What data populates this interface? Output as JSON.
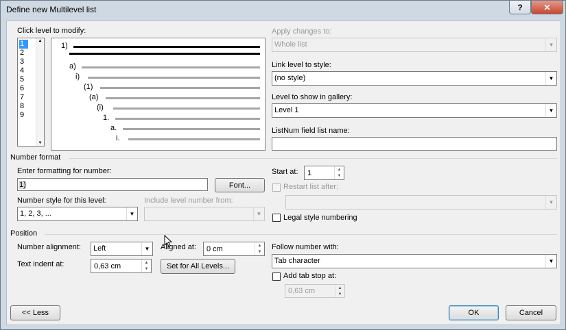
{
  "window": {
    "title": "Define new Multilevel list",
    "help_button": "?",
    "close_button": "✕"
  },
  "levels": {
    "label": "Click level to modify:",
    "items": [
      "1",
      "2",
      "3",
      "4",
      "5",
      "6",
      "7",
      "8",
      "9"
    ],
    "selected": "1"
  },
  "preview": {
    "labels": [
      "1)",
      "a)",
      "i)",
      "(1)",
      "(a)",
      "(i)",
      "1.",
      "a.",
      "i."
    ]
  },
  "apply_changes": {
    "label": "Apply changes to:",
    "value": "Whole list"
  },
  "link_level": {
    "label": "Link level to style:",
    "value": "(no style)"
  },
  "gallery_level": {
    "label": "Level to show in gallery:",
    "value": "Level 1"
  },
  "listnum": {
    "label": "ListNum field list name:",
    "value": ""
  },
  "number_format": {
    "section": "Number format",
    "enter_label": "Enter formatting for number:",
    "enter_value": "1)",
    "font_button": "Font...",
    "style_label": "Number style for this level:",
    "style_value": "1, 2, 3, ...",
    "include_label": "Include level number from:",
    "include_value": ""
  },
  "start_at": {
    "label": "Start at:",
    "value": "1"
  },
  "restart": {
    "label": "Restart list after:",
    "value": ""
  },
  "legal": {
    "label": "Legal style numbering"
  },
  "position": {
    "section": "Position",
    "alignment_label": "Number alignment:",
    "alignment_value": "Left",
    "aligned_at_label": "Aligned at:",
    "aligned_at_value": "0 cm",
    "indent_label": "Text indent at:",
    "indent_value": "0,63 cm",
    "set_all_button": "Set for All Levels..."
  },
  "follow": {
    "label": "Follow number with:",
    "value": "Tab character"
  },
  "tab_stop": {
    "label": "Add tab stop at:",
    "value": "0,63 cm"
  },
  "buttons": {
    "less": "<< Less",
    "ok": "OK",
    "cancel": "Cancel"
  },
  "colors": {
    "selection": "#3399ff",
    "frame": "#cfd9e3",
    "close": "#c7472e"
  }
}
